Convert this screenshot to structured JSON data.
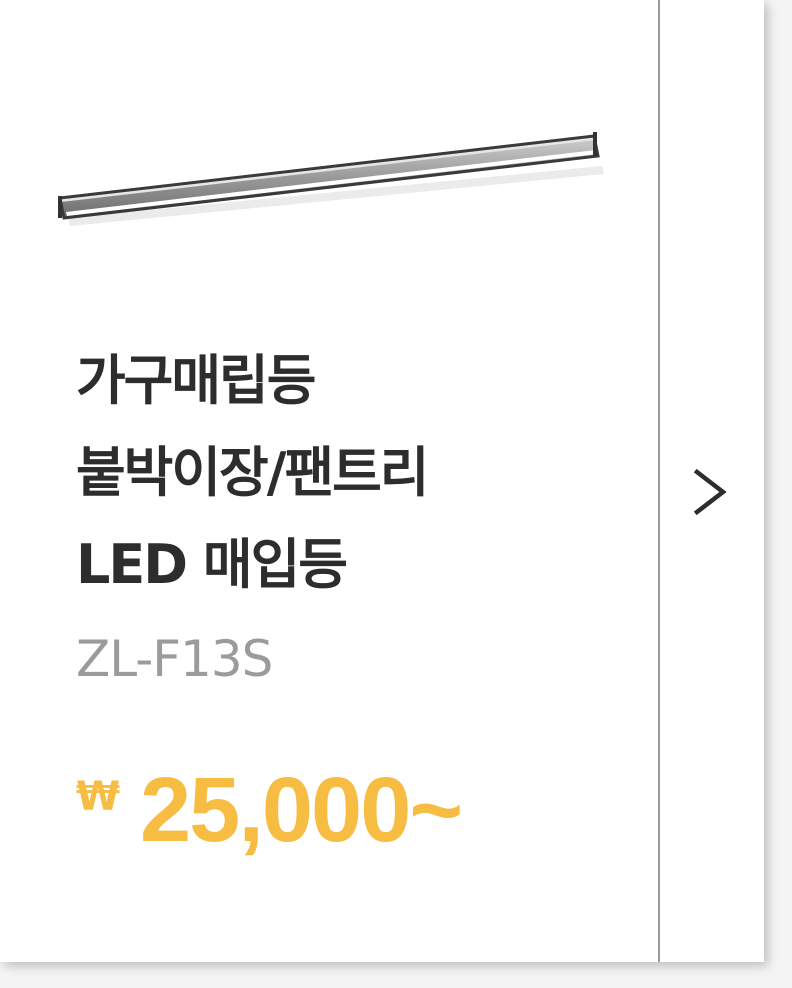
{
  "product": {
    "title_lines": [
      "가구매립등",
      "붙박이장/팬트리",
      "LED 매입등"
    ],
    "model": "ZL-F13S",
    "currency_symbol": "₩",
    "price": "25,000~"
  },
  "navigation": {
    "next_icon": "chevron-right-icon"
  },
  "colors": {
    "title": "#2d2d2d",
    "model": "#9b9b9b",
    "price": "#f7bd42",
    "divider": "#9a9a9a"
  }
}
